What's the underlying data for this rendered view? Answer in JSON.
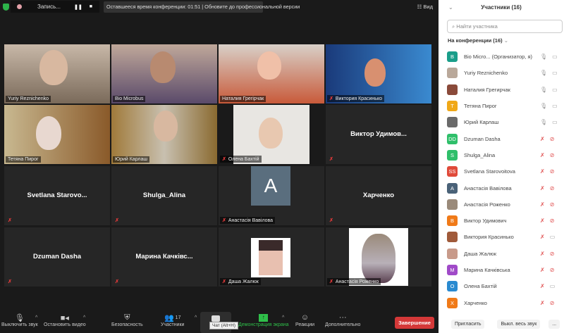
{
  "topbar": {
    "recording_label": "Запись...",
    "notice": "Оставшееся время конференции: 01:51 | Обновите до профессиональной версии",
    "view_label": "Вид"
  },
  "tiles": [
    {
      "name": "Yuriy Reznichenko"
    },
    {
      "name": "Bio Microbus"
    },
    {
      "name": "Наталия Грегірчак"
    },
    {
      "name": "Виктория Красинько"
    },
    {
      "name": "Тетяна Пирог"
    },
    {
      "name": "Юрий Карлаш"
    },
    {
      "name": "Олена Бахтій"
    },
    {
      "name": "Виктор  Удимов..."
    },
    {
      "name": "Svetlana  Starovo..."
    },
    {
      "name": "Shulga_Alina"
    },
    {
      "name": "Анастасія Вавілова",
      "initial": "A"
    },
    {
      "name": "Харченко"
    },
    {
      "name": "Dzuman Dasha"
    },
    {
      "name": "Марина  Качківс..."
    },
    {
      "name": "Даша Жалюк"
    },
    {
      "name": "Анастасія Роженко"
    }
  ],
  "toolbar": {
    "mute": "Выключить звук",
    "video": "Остановить видео",
    "security": "Безопасность",
    "participants": "Участники",
    "participants_count": "17",
    "chat_tooltip": "Чат (Alt+H)",
    "share": "Демонстрация экрана",
    "reactions": "Реакции",
    "more": "Дополнительно",
    "end": "Завершение"
  },
  "panel": {
    "title": "Участники (16)",
    "search_placeholder": "Найти участника",
    "section": "На конференции (16)",
    "invite": "Пригласить",
    "mute_all": "Выкл. весь звук",
    "more": "...",
    "participants": [
      {
        "initials": "B",
        "name": "Bio Micro...  (Организатор, я)",
        "color": "#1a9e8a",
        "mic": "on",
        "cam": "on"
      },
      {
        "initials": "",
        "name": "Yuriy Reznichenko",
        "color": "#b9a89a",
        "mic": "on",
        "cam": "on"
      },
      {
        "initials": "",
        "name": "Наталия Грегирчак",
        "color": "#8a4a3a",
        "mic": "on",
        "cam": "on"
      },
      {
        "initials": "T",
        "name": "Тетяна Пирог",
        "color": "#f0a818",
        "mic": "on",
        "cam": "on"
      },
      {
        "initials": "",
        "name": "Юрий Карлаш",
        "color": "#6a6a6a",
        "mic": "on",
        "cam": "on"
      },
      {
        "initials": "DD",
        "name": "Dzuman Dasha",
        "color": "#2fbf6a",
        "mic": "off",
        "cam": "off"
      },
      {
        "initials": "S",
        "name": "Shulga_Alina",
        "color": "#2fbf6a",
        "mic": "off",
        "cam": "off"
      },
      {
        "initials": "SS",
        "name": "Svetlana Starovoitova",
        "color": "#e04a3a",
        "mic": "off",
        "cam": "off"
      },
      {
        "initials": "A",
        "name": "Анастасія Вавілова",
        "color": "#4a6278",
        "mic": "off",
        "cam": "off"
      },
      {
        "initials": "",
        "name": "Анастасія Роженко",
        "color": "#9a8a7a",
        "mic": "off",
        "cam": "off"
      },
      {
        "initials": "B",
        "name": "Виктор Удимович",
        "color": "#f07a18",
        "mic": "off",
        "cam": "off"
      },
      {
        "initials": "",
        "name": "Виктория Красинько",
        "color": "#a05a3a",
        "mic": "off",
        "cam": "on"
      },
      {
        "initials": "",
        "name": "Даша Жалюк",
        "color": "#c89a8a",
        "mic": "off",
        "cam": "off"
      },
      {
        "initials": "M",
        "name": "Марина Качківська",
        "color": "#a04ac8",
        "mic": "off",
        "cam": "off"
      },
      {
        "initials": "O",
        "name": "Олена Бахтій",
        "color": "#2a8ad0",
        "mic": "off",
        "cam": "on"
      },
      {
        "initials": "X",
        "name": "Харченко",
        "color": "#f07a18",
        "mic": "off",
        "cam": "off"
      }
    ]
  }
}
